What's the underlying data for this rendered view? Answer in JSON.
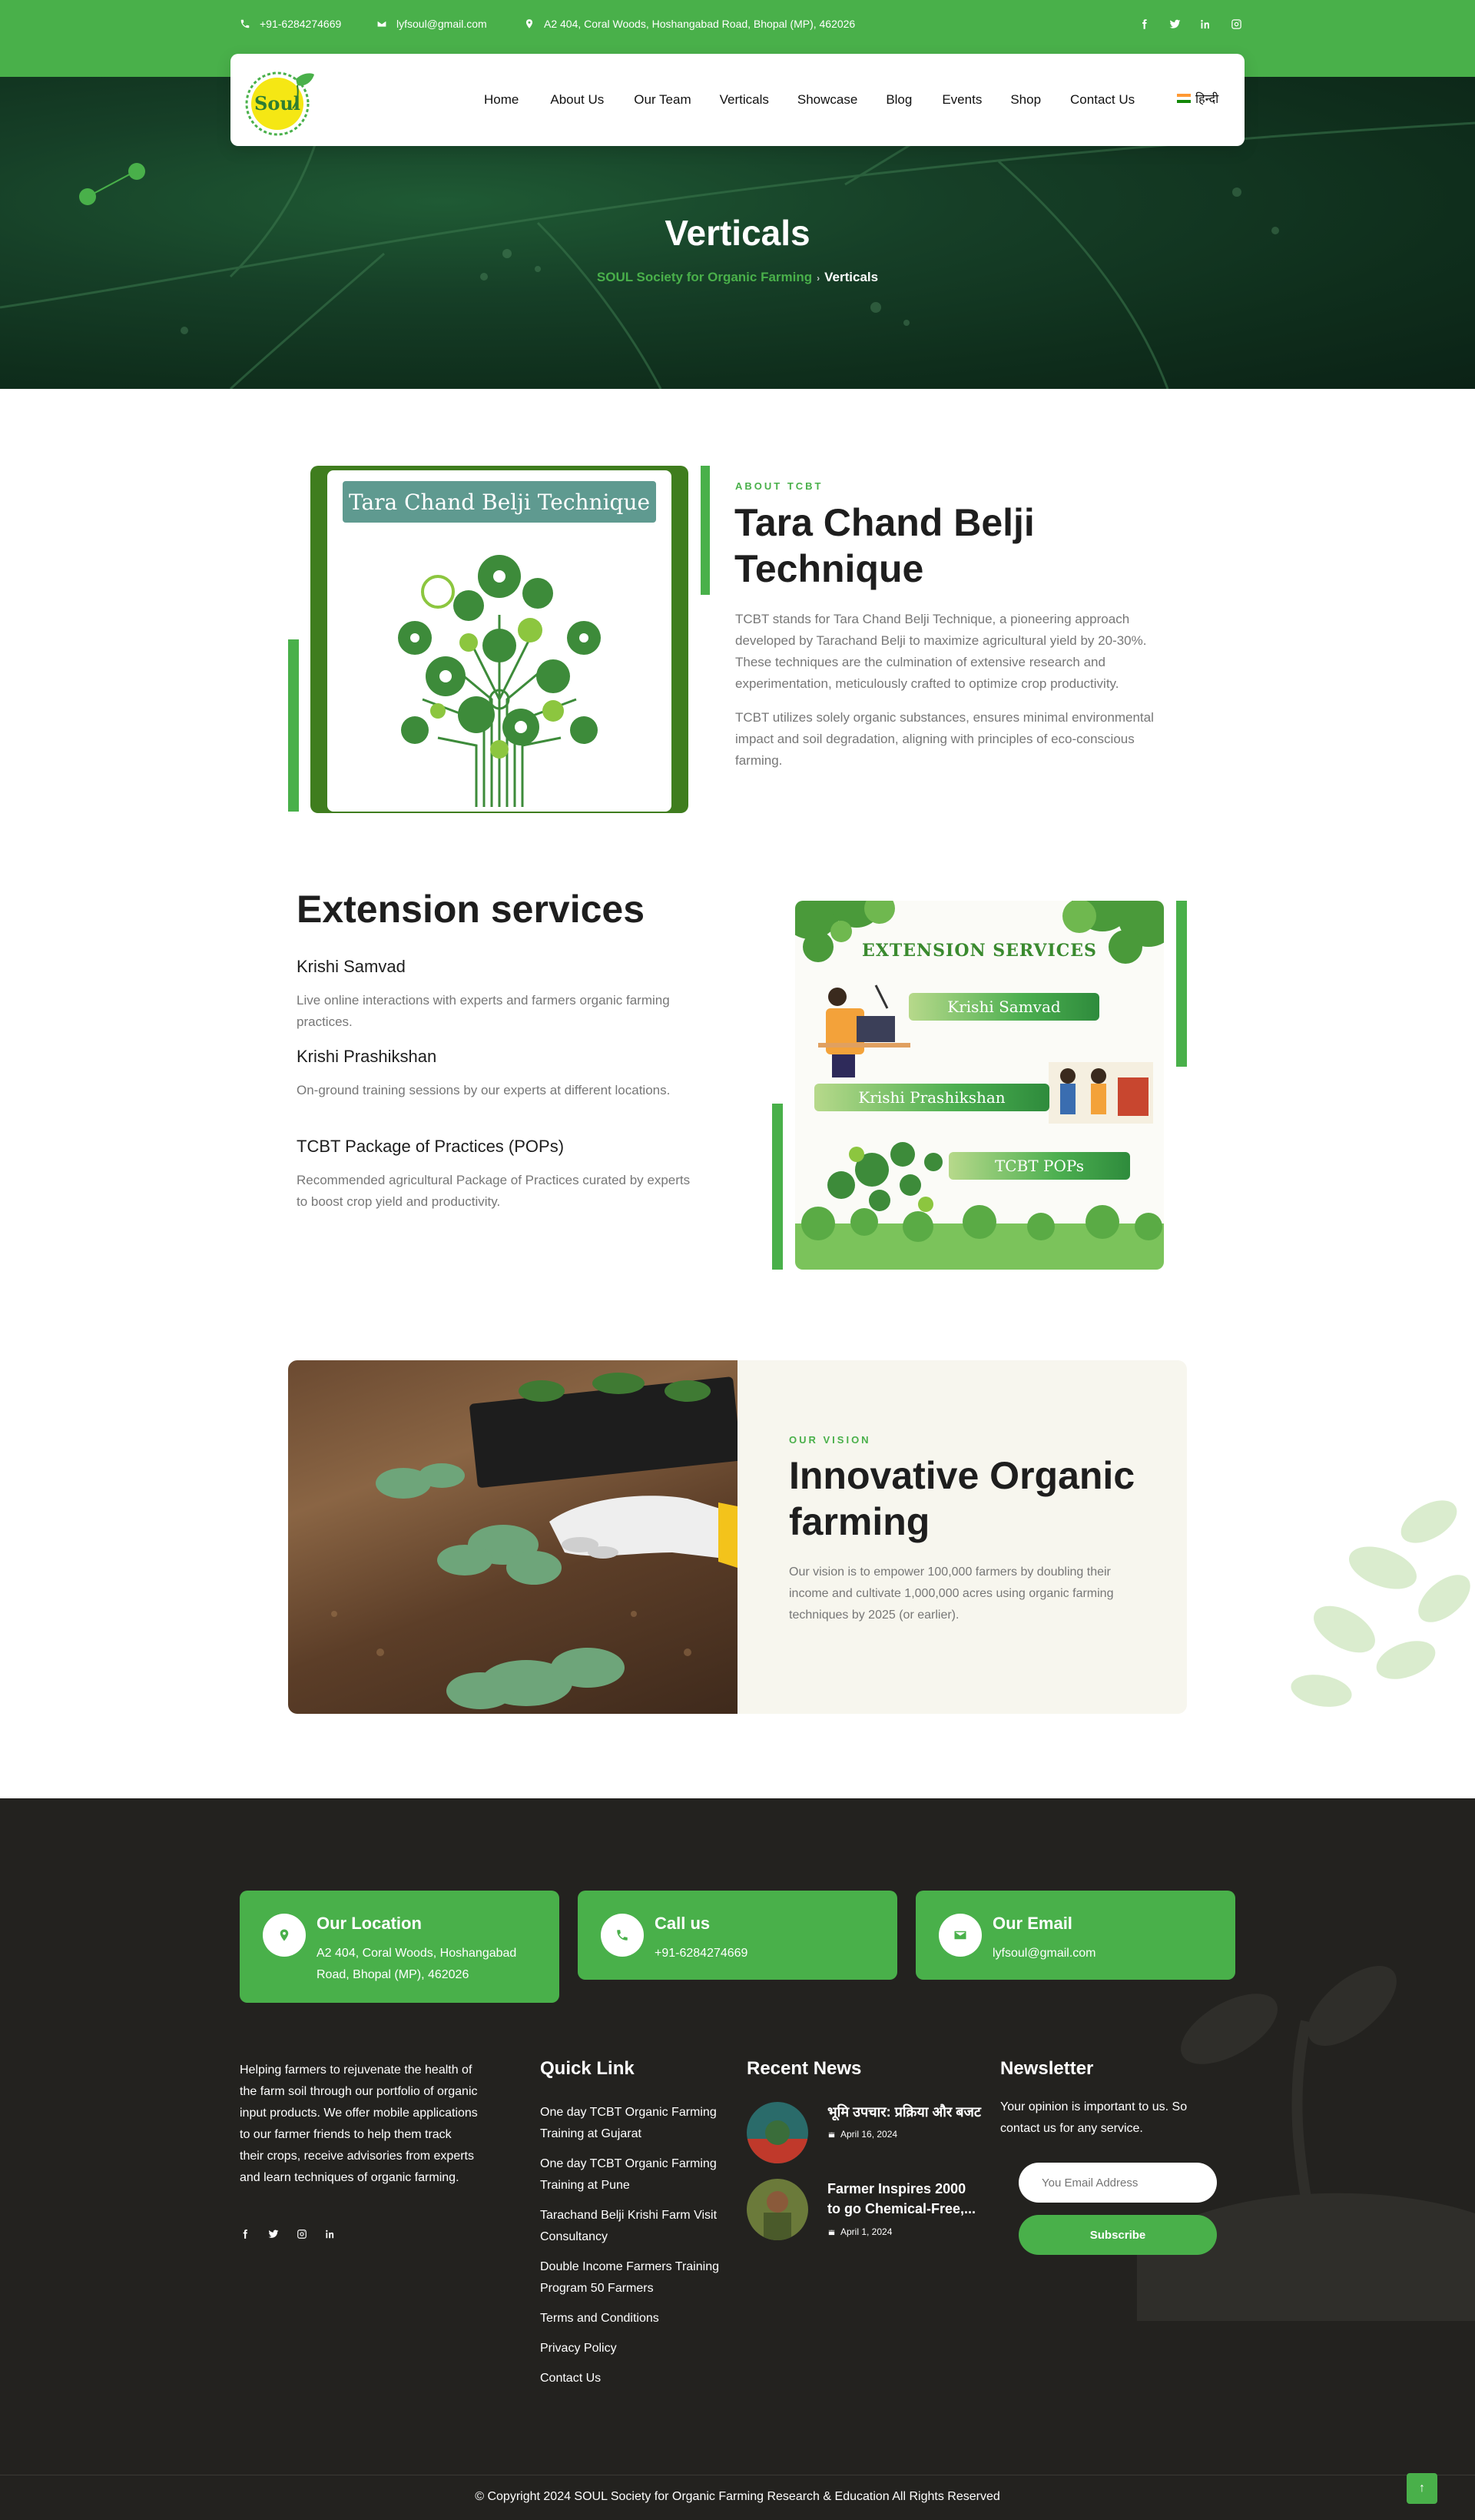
{
  "topbar": {
    "phone": "+91-6284274669",
    "email": "lyfsoul@gmail.com",
    "address": "A2 404, Coral Woods, Hoshangabad Road, Bhopal (MP), 462026",
    "social_icons": [
      "facebook-icon",
      "twitter-icon",
      "linkedin-icon",
      "instagram-icon"
    ]
  },
  "header": {
    "logo_text": "Soul",
    "nav": [
      "Home",
      "About Us",
      "Our Team",
      "Verticals",
      "Showcase",
      "Blog",
      "Events",
      "Shop",
      "Contact Us"
    ],
    "language": "हिन्दी"
  },
  "hero": {
    "title": "Verticals",
    "breadcrumb_home": "SOUL Society for Organic Farming",
    "breadcrumb_current": "Verticals"
  },
  "about": {
    "eyebrow": "ABOUT TCBT",
    "title": "Tara Chand Belji Technique",
    "image_caption": "Tara Chand Belji Technique",
    "paragraph1": "TCBT stands for Tara Chand Belji Technique, a pioneering approach developed by Tarachand Belji to maximize agricultural yield by 20-30%. These techniques are the culmination of extensive research and experimentation, meticulously crafted to optimize crop productivity.",
    "paragraph2": "TCBT utilizes solely organic substances, ensures minimal environmental impact and soil degradation, aligning with principles of eco-conscious farming."
  },
  "extension": {
    "title": "Extension services",
    "items": [
      {
        "title": "Krishi Samvad",
        "desc": "Live online interactions with experts and farmers organic farming practices."
      },
      {
        "title": "Krishi Prashikshan",
        "desc": "On-ground training sessions by our experts at different locations."
      },
      {
        "title": "TCBT Package of Practices (POPs)",
        "desc": " Recommended agricultural Package of Practices curated by experts to boost crop yield and productivity."
      }
    ],
    "image_heading": "EXTENSION SERVICES",
    "image_pills": [
      "Krishi Samvad",
      "Krishi Prashikshan",
      "TCBT POPs"
    ]
  },
  "vision": {
    "eyebrow": "OUR VISION",
    "title": "Innovative Organic farming",
    "text": "Our vision is to empower 100,000 farmers by doubling their income and cultivate 1,000,000 acres using organic farming techniques by 2025 (or earlier)."
  },
  "footer": {
    "cards": [
      {
        "title": "Our Location",
        "value": "A2 404, Coral Woods, Hoshangabad Road, Bhopal (MP), 462026",
        "icon": "location-icon"
      },
      {
        "title": "Call us",
        "value": "+91-6284274669",
        "icon": "phone-icon"
      },
      {
        "title": "Our Email",
        "value": "lyfsoul@gmail.com",
        "icon": "email-icon"
      }
    ],
    "about": "Helping farmers to rejuvenate the health of the farm soil through our portfolio of organic input products. We offer mobile applications to our farmer friends to help them track their crops, receive advisories from experts and learn techniques of organic farming.",
    "quick_link_heading": "Quick Link",
    "quick_links": [
      "One day TCBT Organic Farming Training at Gujarat",
      "One day TCBT Organic Farming Training at Pune",
      "Tarachand Belji Krishi Farm Visit Consultancy",
      "Double Income Farmers Training Program 50 Farmers",
      "Terms and Conditions",
      "Privacy Policy",
      "Contact Us"
    ],
    "news_heading": "Recent News",
    "news": [
      {
        "title": "भूमि उपचार: प्रक्रिया और बजट",
        "date": "April 16, 2024"
      },
      {
        "title": "Farmer Inspires 2000 to go Chemical-Free,...",
        "date": "April 1, 2024"
      }
    ],
    "newsletter_heading": "Newsletter",
    "newsletter_text": "Your opinion is important to us. So contact us for any service.",
    "newsletter_placeholder": "You Email Address",
    "subscribe_label": "Subscribe",
    "copyright": "© Copyright 2024 SOUL Society for Organic Farming Research & Education All Rights Reserved",
    "back_to_top": "↑"
  },
  "colors": {
    "accent": "#49b04a",
    "dark_green": "#3f7d1e",
    "footer_bg": "#23221f",
    "vision_bg": "#f7f6ee"
  }
}
